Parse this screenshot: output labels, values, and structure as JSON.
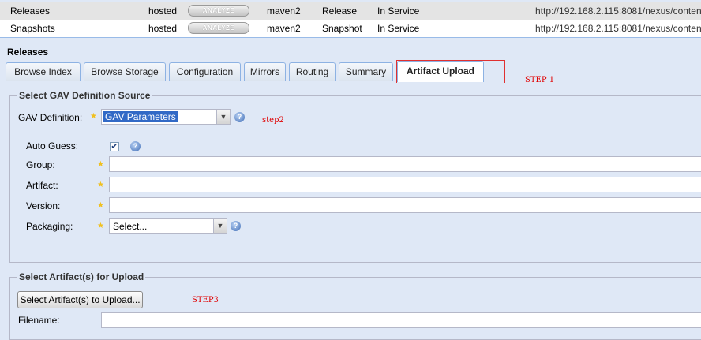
{
  "repositories": [
    {
      "name": "Releases",
      "type": "hosted",
      "analyze": "ANALYZE",
      "format": "maven2",
      "policy": "Release",
      "status": "In Service",
      "url": "http://192.168.2.115:8081/nexus/conten"
    },
    {
      "name": "Snapshots",
      "type": "hosted",
      "analyze": "ANALYZE",
      "format": "maven2",
      "policy": "Snapshot",
      "status": "In Service",
      "url": "http://192.168.2.115:8081/nexus/conten"
    }
  ],
  "panel": {
    "title": "Releases"
  },
  "tabs": [
    {
      "label": "Browse Index"
    },
    {
      "label": "Browse Storage"
    },
    {
      "label": "Configuration"
    },
    {
      "label": "Mirrors"
    },
    {
      "label": "Routing"
    },
    {
      "label": "Summary"
    },
    {
      "label": "Artifact Upload",
      "active": true
    }
  ],
  "annotations": {
    "step1": "STEP 1",
    "step2": "step2",
    "step3": "STEP3"
  },
  "gav_source": {
    "legend": "Select GAV Definition Source",
    "definition_label": "GAV Definition:",
    "definition_value": "GAV Parameters",
    "auto_guess_label": "Auto Guess:",
    "auto_guess_checked": true,
    "group_label": "Group:",
    "artifact_label": "Artifact:",
    "version_label": "Version:",
    "packaging_label": "Packaging:",
    "packaging_value": "Select..."
  },
  "upload": {
    "legend": "Select Artifact(s) for Upload",
    "select_button": "Select Artifact(s) to Upload...",
    "filename_label": "Filename:"
  },
  "icons": {
    "required": "star-icon",
    "help": "help-icon",
    "dropdown": "chevron-down-icon",
    "check": "check-icon"
  }
}
